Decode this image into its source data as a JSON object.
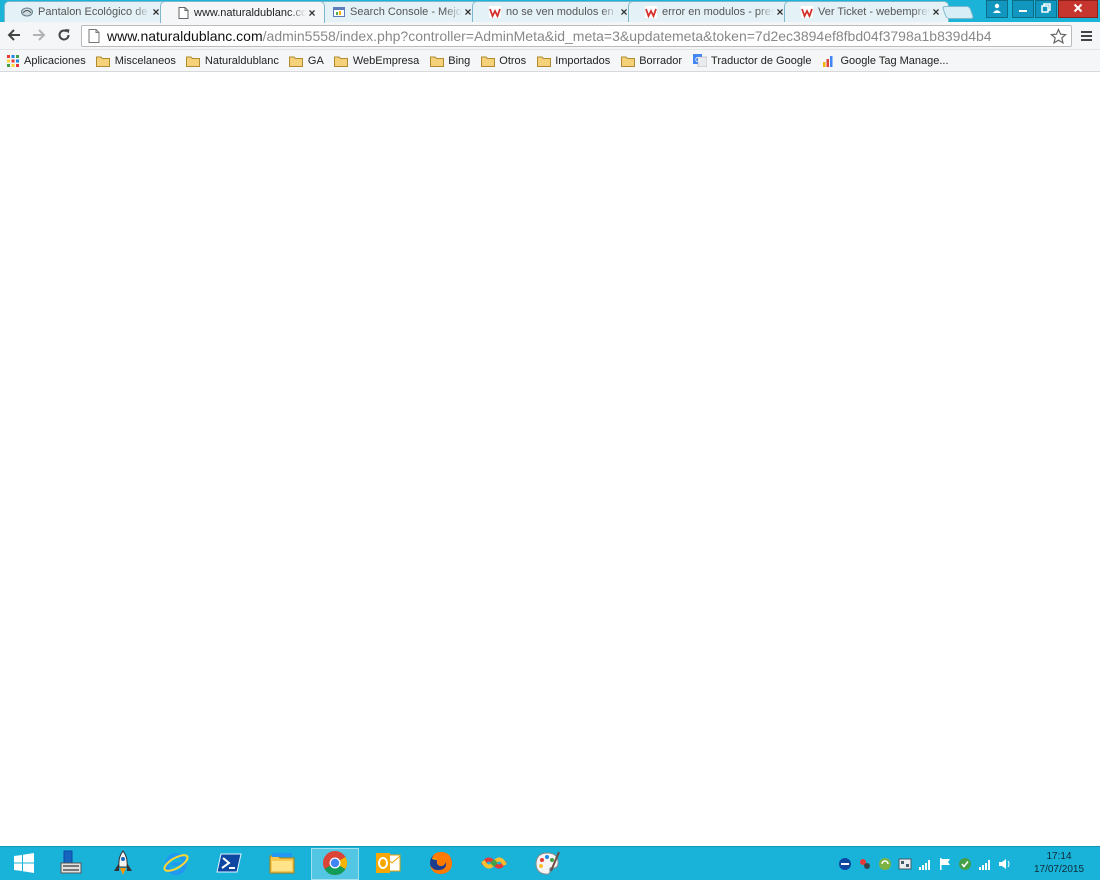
{
  "browser": {
    "tabs": [
      {
        "title": "Pantalon Ecológico de H",
        "favicon": "prestashop-icon",
        "active": false
      },
      {
        "title": "www.naturaldublanc.com",
        "favicon": "page-icon",
        "active": true
      },
      {
        "title": "Search Console - Mejora",
        "favicon": "search-console-icon",
        "active": false
      },
      {
        "title": "no se ven modulos en p",
        "favicon": "webempresa-icon",
        "active": false
      },
      {
        "title": "error en modulos - pres",
        "favicon": "webempresa-icon",
        "active": false
      },
      {
        "title": "Ver Ticket - webempresa",
        "favicon": "webempresa-icon",
        "active": false
      }
    ],
    "address": {
      "host": "www.naturaldublanc.com",
      "path": "/admin5558/index.php?controller=AdminMeta&id_meta=3&updatemeta&token=7d2ec3894ef8fbd04f3798a1b839d4b4"
    },
    "bookmarks": [
      {
        "label": "Aplicaciones",
        "icon": "apps-grid-icon"
      },
      {
        "label": "Miscelaneos",
        "icon": "folder-icon"
      },
      {
        "label": "Naturaldublanc",
        "icon": "folder-icon"
      },
      {
        "label": "GA",
        "icon": "folder-icon"
      },
      {
        "label": "WebEmpresa",
        "icon": "folder-icon"
      },
      {
        "label": "Bing",
        "icon": "folder-icon"
      },
      {
        "label": "Otros",
        "icon": "folder-icon"
      },
      {
        "label": "Importados",
        "icon": "folder-icon"
      },
      {
        "label": "Borrador",
        "icon": "folder-icon"
      },
      {
        "label": "Traductor de Google",
        "icon": "google-translate-icon"
      },
      {
        "label": "Google Tag Manage...",
        "icon": "tag-manager-icon"
      }
    ]
  },
  "taskbar": {
    "apps": [
      {
        "name": "start-button",
        "icon": "windows-logo-icon",
        "active": false
      },
      {
        "name": "server-manager",
        "icon": "server-manager-icon",
        "active": false
      },
      {
        "name": "launcher",
        "icon": "rocket-icon",
        "active": false
      },
      {
        "name": "internet-explorer",
        "icon": "internet-explorer-icon",
        "active": false
      },
      {
        "name": "powershell",
        "icon": "powershell-icon",
        "active": false
      },
      {
        "name": "file-explorer",
        "icon": "file-explorer-icon",
        "active": false
      },
      {
        "name": "chrome",
        "icon": "chrome-icon",
        "active": true
      },
      {
        "name": "outlook",
        "icon": "outlook-icon",
        "active": false
      },
      {
        "name": "firefox",
        "icon": "firefox-icon",
        "active": false
      },
      {
        "name": "app-colorful",
        "icon": "colorful-app-icon",
        "active": false
      },
      {
        "name": "paint",
        "icon": "paint-palette-icon",
        "active": false
      }
    ],
    "clock": {
      "time": "17:14",
      "date": "17/07/2015"
    }
  },
  "colors": {
    "tab_strip": "#1bb4d8",
    "taskbar": "#19b3da",
    "close_button": "#c7362e"
  }
}
